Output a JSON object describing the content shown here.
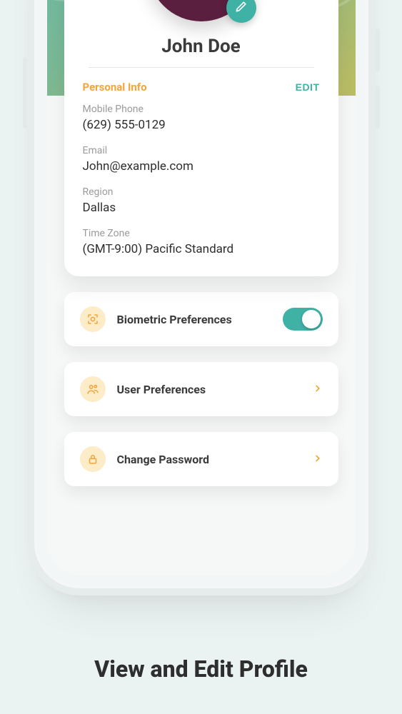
{
  "profile": {
    "name": "John Doe",
    "section_title": "Personal Info",
    "edit_label": "EDIT",
    "fields": {
      "phone": {
        "label": "Mobile Phone",
        "value": "(629) 555-0129"
      },
      "email": {
        "label": "Email",
        "value": "John@example.com"
      },
      "region": {
        "label": "Region",
        "value": "Dallas"
      },
      "timezone": {
        "label": "Time Zone",
        "value": "(GMT-9:00) Pacific Standard"
      }
    }
  },
  "rows": {
    "biometric": {
      "label": "Biometric Preferences",
      "toggle_on": true
    },
    "user_prefs": {
      "label": "User Preferences"
    },
    "password": {
      "label": "Change Password"
    }
  },
  "caption": "View and Edit Profile",
  "colors": {
    "accent_teal": "#3fb1a5",
    "accent_orange": "#f3a43a"
  }
}
